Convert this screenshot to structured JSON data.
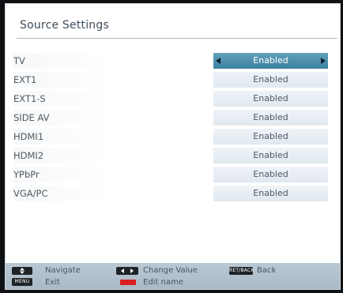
{
  "header": {
    "title": "Source Settings"
  },
  "sources": [
    {
      "label": "TV",
      "value": "Enabled",
      "selected": true
    },
    {
      "label": "EXT1",
      "value": "Enabled"
    },
    {
      "label": "EXT1-S",
      "value": "Enabled"
    },
    {
      "label": "SIDE AV",
      "value": "Enabled"
    },
    {
      "label": "HDMI1",
      "value": "Enabled"
    },
    {
      "label": "HDMI2",
      "value": "Enabled"
    },
    {
      "label": "YPbPr",
      "value": "Enabled"
    },
    {
      "label": "VGA/PC",
      "value": "Enabled"
    }
  ],
  "footer": {
    "navigate": "Navigate",
    "change_value": "Change Value",
    "back": "Back",
    "back_key": "RET/BACK",
    "exit": "Exit",
    "menu_key": "MENU",
    "edit_name": "Edit name"
  },
  "colors": {
    "selected_value_bg": "#3a7f9f",
    "value_bg": "#e1e9ef",
    "footer_bg": "#b0bfcb",
    "red_key": "#d81e1e"
  },
  "icons": {
    "navigate": "up-down-icon",
    "change_value": "left-right-icon",
    "edit_name": "red-button-icon"
  }
}
